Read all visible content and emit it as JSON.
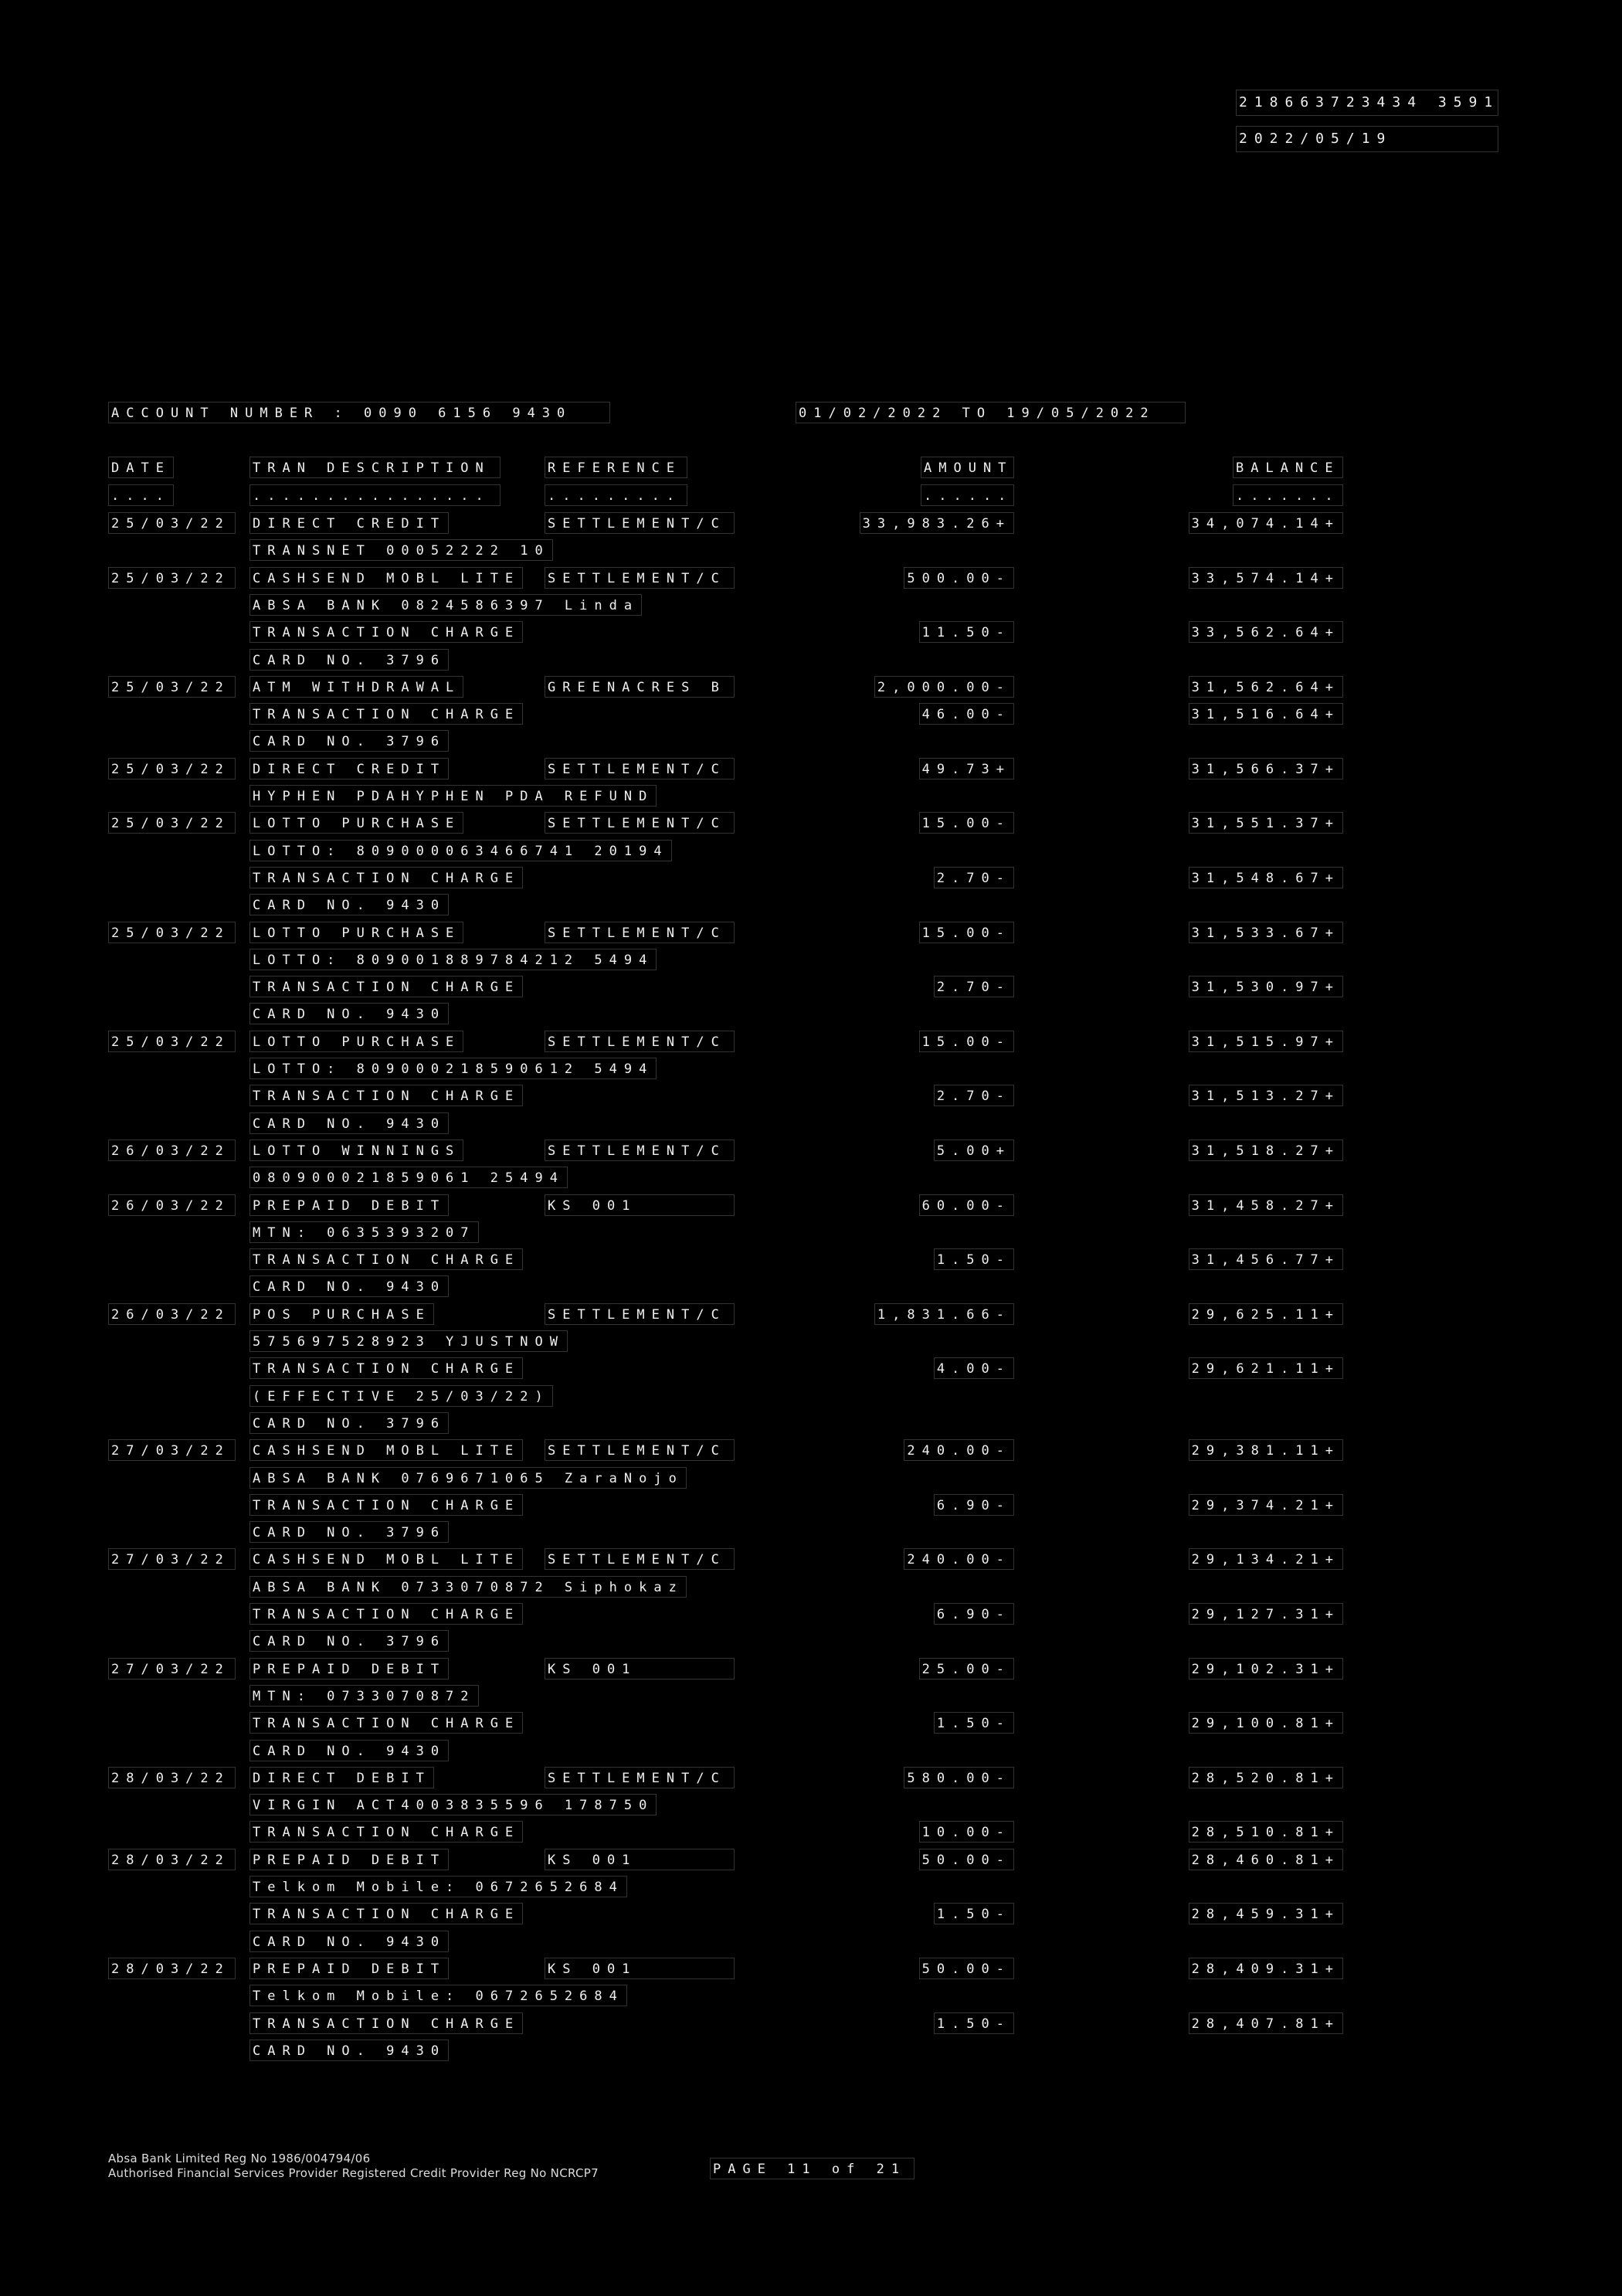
{
  "top_reference": "218663723434 3591",
  "top_date": "2022/05/19",
  "account_line": "ACCOUNT NUMBER : 0090 6156 9430",
  "period": "01/02/2022 TO 19/05/2022",
  "headers": {
    "date": "DATE",
    "description": "TRAN DESCRIPTION",
    "reference": "REFERENCE",
    "amount": "AMOUNT",
    "balance": "BALANCE"
  },
  "underlines": {
    "date": "....",
    "description": "................",
    "reference": ".........",
    "amount": "......",
    "balance": "......."
  },
  "rows": [
    {
      "date": "25/03/22",
      "desc": "DIRECT CREDIT",
      "ref": "SETTLEMENT/C",
      "amount": "33,983.26+",
      "balance": "34,074.14+"
    },
    {
      "date": "",
      "desc": "TRANSNET 00052222 10",
      "ref": "",
      "amount": "",
      "balance": ""
    },
    {
      "date": "25/03/22",
      "desc": "CASHSEND MOBL LITE",
      "ref": "SETTLEMENT/C",
      "amount": "500.00-",
      "balance": "33,574.14+"
    },
    {
      "date": "",
      "desc": "ABSA BANK 0824586397 Linda",
      "ref": "",
      "amount": "",
      "balance": ""
    },
    {
      "date": "",
      "desc": "TRANSACTION CHARGE",
      "ref": "",
      "amount": "11.50-",
      "balance": "33,562.64+"
    },
    {
      "date": "",
      "desc": "CARD NO. 3796",
      "ref": "",
      "amount": "",
      "balance": ""
    },
    {
      "date": "25/03/22",
      "desc": "ATM WITHDRAWAL",
      "ref": "GREENACRES B",
      "amount": "2,000.00-",
      "balance": "31,562.64+"
    },
    {
      "date": "",
      "desc": "TRANSACTION CHARGE",
      "ref": "",
      "amount": "46.00-",
      "balance": "31,516.64+"
    },
    {
      "date": "",
      "desc": "CARD NO. 3796",
      "ref": "",
      "amount": "",
      "balance": ""
    },
    {
      "date": "25/03/22",
      "desc": "DIRECT CREDIT",
      "ref": "SETTLEMENT/C",
      "amount": "49.73+",
      "balance": "31,566.37+"
    },
    {
      "date": "",
      "desc": "HYPHEN PDAHYPHEN PDA REFUND",
      "ref": "",
      "amount": "",
      "balance": ""
    },
    {
      "date": "25/03/22",
      "desc": "LOTTO PURCHASE",
      "ref": "SETTLEMENT/C",
      "amount": "15.00-",
      "balance": "31,551.37+"
    },
    {
      "date": "",
      "desc": "LOTTO: 809000063466741 20194",
      "ref": "",
      "amount": "",
      "balance": ""
    },
    {
      "date": "",
      "desc": "TRANSACTION CHARGE",
      "ref": "",
      "amount": "2.70-",
      "balance": "31,548.67+"
    },
    {
      "date": "",
      "desc": "CARD NO. 9430",
      "ref": "",
      "amount": "",
      "balance": ""
    },
    {
      "date": "25/03/22",
      "desc": "LOTTO PURCHASE",
      "ref": "SETTLEMENT/C",
      "amount": "15.00-",
      "balance": "31,533.67+"
    },
    {
      "date": "",
      "desc": "LOTTO: 809001889784212 5494",
      "ref": "",
      "amount": "",
      "balance": ""
    },
    {
      "date": "",
      "desc": "TRANSACTION CHARGE",
      "ref": "",
      "amount": "2.70-",
      "balance": "31,530.97+"
    },
    {
      "date": "",
      "desc": "CARD NO. 9430",
      "ref": "",
      "amount": "",
      "balance": ""
    },
    {
      "date": "25/03/22",
      "desc": "LOTTO PURCHASE",
      "ref": "SETTLEMENT/C",
      "amount": "15.00-",
      "balance": "31,515.97+"
    },
    {
      "date": "",
      "desc": "LOTTO: 809000218590612 5494",
      "ref": "",
      "amount": "",
      "balance": ""
    },
    {
      "date": "",
      "desc": "TRANSACTION CHARGE",
      "ref": "",
      "amount": "2.70-",
      "balance": "31,513.27+"
    },
    {
      "date": "",
      "desc": "CARD NO. 9430",
      "ref": "",
      "amount": "",
      "balance": ""
    },
    {
      "date": "26/03/22",
      "desc": "LOTTO WINNINGS",
      "ref": "SETTLEMENT/C",
      "amount": "5.00+",
      "balance": "31,518.27+"
    },
    {
      "date": "",
      "desc": "080900021859061 25494",
      "ref": "",
      "amount": "",
      "balance": ""
    },
    {
      "date": "26/03/22",
      "desc": "PREPAID DEBIT",
      "ref": "KS 001",
      "amount": "60.00-",
      "balance": "31,458.27+"
    },
    {
      "date": "",
      "desc": "MTN: 0635393207",
      "ref": "",
      "amount": "",
      "balance": ""
    },
    {
      "date": "",
      "desc": "TRANSACTION CHARGE",
      "ref": "",
      "amount": "1.50-",
      "balance": "31,456.77+"
    },
    {
      "date": "",
      "desc": "CARD NO. 9430",
      "ref": "",
      "amount": "",
      "balance": ""
    },
    {
      "date": "26/03/22",
      "desc": "POS PURCHASE",
      "ref": "SETTLEMENT/C",
      "amount": "1,831.66-",
      "balance": "29,625.11+"
    },
    {
      "date": "",
      "desc": "575697528923 YJUSTNOW",
      "ref": "",
      "amount": "",
      "balance": ""
    },
    {
      "date": "",
      "desc": "TRANSACTION CHARGE",
      "ref": "",
      "amount": "4.00-",
      "balance": "29,621.11+"
    },
    {
      "date": "",
      "desc": "(EFFECTIVE 25/03/22)",
      "ref": "",
      "amount": "",
      "balance": ""
    },
    {
      "date": "",
      "desc": "CARD NO. 3796",
      "ref": "",
      "amount": "",
      "balance": ""
    },
    {
      "date": "27/03/22",
      "desc": "CASHSEND MOBL LITE",
      "ref": "SETTLEMENT/C",
      "amount": "240.00-",
      "balance": "29,381.11+"
    },
    {
      "date": "",
      "desc": "ABSA BANK 0769671065 ZaraNojo",
      "ref": "",
      "amount": "",
      "balance": ""
    },
    {
      "date": "",
      "desc": "TRANSACTION CHARGE",
      "ref": "",
      "amount": "6.90-",
      "balance": "29,374.21+"
    },
    {
      "date": "",
      "desc": "CARD NO. 3796",
      "ref": "",
      "amount": "",
      "balance": ""
    },
    {
      "date": "27/03/22",
      "desc": "CASHSEND MOBL LITE",
      "ref": "SETTLEMENT/C",
      "amount": "240.00-",
      "balance": "29,134.21+"
    },
    {
      "date": "",
      "desc": "ABSA BANK 0733070872 Siphokaz",
      "ref": "",
      "amount": "",
      "balance": ""
    },
    {
      "date": "",
      "desc": "TRANSACTION CHARGE",
      "ref": "",
      "amount": "6.90-",
      "balance": "29,127.31+"
    },
    {
      "date": "",
      "desc": "CARD NO. 3796",
      "ref": "",
      "amount": "",
      "balance": ""
    },
    {
      "date": "27/03/22",
      "desc": "PREPAID DEBIT",
      "ref": "KS 001",
      "amount": "25.00-",
      "balance": "29,102.31+"
    },
    {
      "date": "",
      "desc": "MTN: 0733070872",
      "ref": "",
      "amount": "",
      "balance": ""
    },
    {
      "date": "",
      "desc": "TRANSACTION CHARGE",
      "ref": "",
      "amount": "1.50-",
      "balance": "29,100.81+"
    },
    {
      "date": "",
      "desc": "CARD NO. 9430",
      "ref": "",
      "amount": "",
      "balance": ""
    },
    {
      "date": "28/03/22",
      "desc": "DIRECT DEBIT",
      "ref": "SETTLEMENT/C",
      "amount": "580.00-",
      "balance": "28,520.81+"
    },
    {
      "date": "",
      "desc": "VIRGIN ACT4003835596 178750",
      "ref": "",
      "amount": "",
      "balance": ""
    },
    {
      "date": "",
      "desc": "TRANSACTION CHARGE",
      "ref": "",
      "amount": "10.00-",
      "balance": "28,510.81+"
    },
    {
      "date": "28/03/22",
      "desc": "PREPAID DEBIT",
      "ref": "KS 001",
      "amount": "50.00-",
      "balance": "28,460.81+"
    },
    {
      "date": "",
      "desc": "Telkom Mobile: 0672652684",
      "ref": "",
      "amount": "",
      "balance": ""
    },
    {
      "date": "",
      "desc": "TRANSACTION CHARGE",
      "ref": "",
      "amount": "1.50-",
      "balance": "28,459.31+"
    },
    {
      "date": "",
      "desc": "CARD NO. 9430",
      "ref": "",
      "amount": "",
      "balance": ""
    },
    {
      "date": "28/03/22",
      "desc": "PREPAID DEBIT",
      "ref": "KS 001",
      "amount": "50.00-",
      "balance": "28,409.31+"
    },
    {
      "date": "",
      "desc": "Telkom Mobile: 0672652684",
      "ref": "",
      "amount": "",
      "balance": ""
    },
    {
      "date": "",
      "desc": "TRANSACTION CHARGE",
      "ref": "",
      "amount": "1.50-",
      "balance": "28,407.81+"
    },
    {
      "date": "",
      "desc": "CARD NO. 9430",
      "ref": "",
      "amount": "",
      "balance": ""
    }
  ],
  "footer": {
    "reg_line": "Absa Bank Limited Reg No 1986/004794/06",
    "fsp_line": "Authorised Financial Services Provider Registered Credit Provider Reg No NCRCP7",
    "page_label": "PAGE 11 of 21"
  }
}
